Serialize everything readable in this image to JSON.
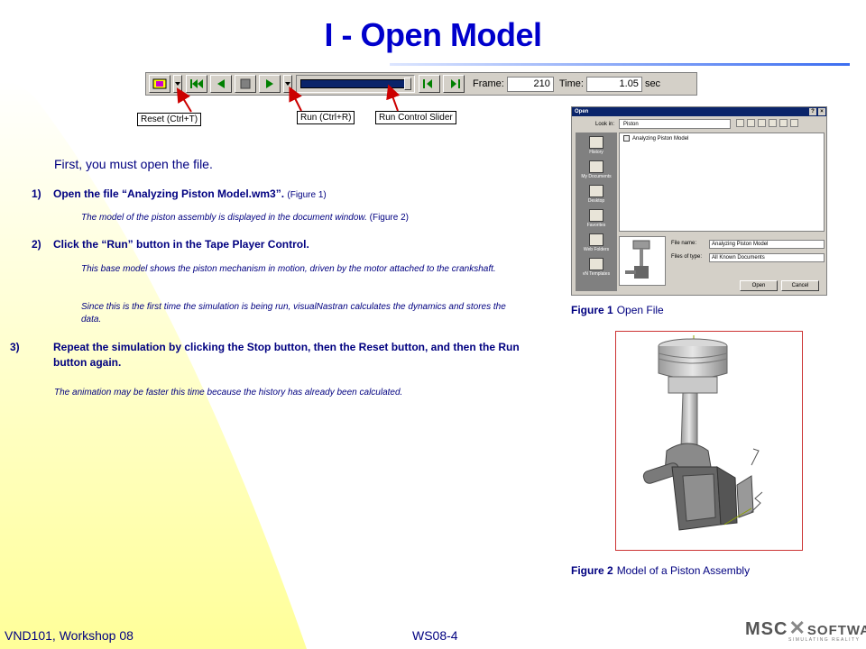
{
  "title": "I - Open Model",
  "toolbar": {
    "frame_label": "Frame:",
    "frame_value": "210",
    "time_label": "Time:",
    "time_value": "1.05",
    "time_unit": "sec"
  },
  "callouts": {
    "reset": "Reset (Ctrl+T)",
    "run": "Run (Ctrl+R)",
    "slider": "Run Control Slider"
  },
  "intro": "First, you must open the file.",
  "steps": [
    {
      "num": "1)",
      "text": "Open the file “Analyzing Piston Model.wm3”.",
      "ref": "(Figure 1)"
    },
    {
      "num": "2)",
      "text": "Click the “Run” button in the Tape Player Control."
    },
    {
      "num": "3)",
      "text": "Repeat the simulation by clicking the Stop button, then the Reset button, and then the Run button again."
    }
  ],
  "notes": {
    "n1": "The model of the piston assembly is displayed in the document window.",
    "n1_ref": "(Figure 2)",
    "n2": "This base model shows the piston mechanism in motion, driven by the motor attached to the crankshaft.",
    "n3": "Since this is the first time the simulation is being run, visualNastran calculates the dynamics and stores the data.",
    "n4": "The animation may be faster this time because the history has already been calculated."
  },
  "dialog": {
    "title": "Open",
    "look_in_label": "Look in:",
    "look_in_value": "Piston",
    "places": [
      "History",
      "My Documents",
      "Desktop",
      "Favorites",
      "Web Folders",
      "vN Templates"
    ],
    "file": "Analyzing Piston Model",
    "file_name_label": "File name:",
    "file_name_value": "Analyzing Piston Model",
    "file_type_label": "Files of type:",
    "file_type_value": "All Known Documents",
    "open_button": "Open",
    "cancel_button": "Cancel"
  },
  "figure1": {
    "label": "Figure 1",
    "text": "Open File"
  },
  "figure2": {
    "label": "Figure 2",
    "text": "Model of a Piston Assembly"
  },
  "footer": {
    "left": "VND101, Workshop 08",
    "page": "WS08-4",
    "logo_main": "MSC",
    "logo_x": "SOFTWARE",
    "logo_tagline": "SIMULATING REALITY"
  },
  "colors": {
    "title": "#0000cc",
    "text": "#000080",
    "accent": "#cc0000"
  }
}
